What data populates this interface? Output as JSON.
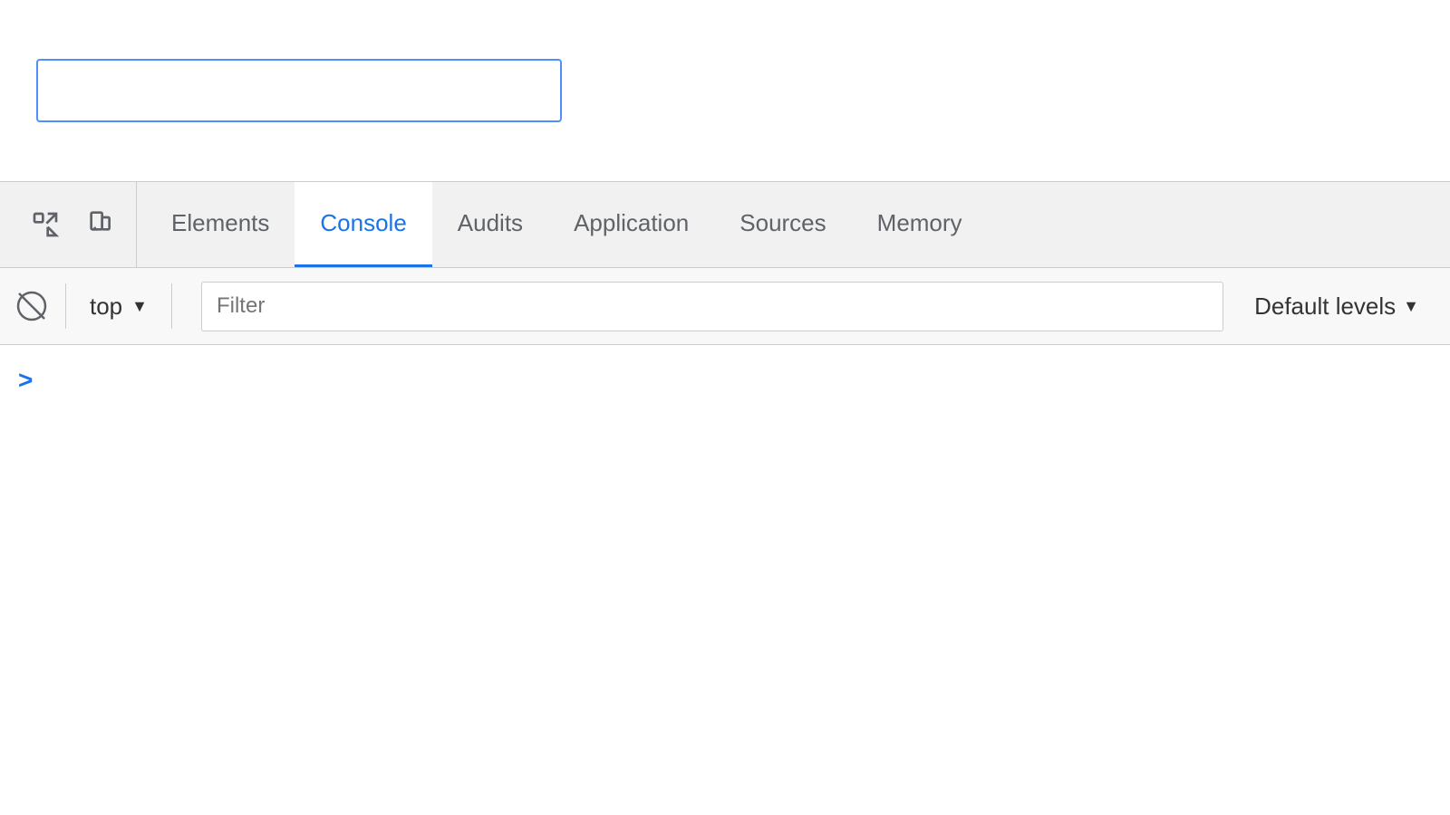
{
  "url_bar": {
    "value": "",
    "placeholder": ""
  },
  "devtools": {
    "tab_bar": {
      "tabs": [
        {
          "id": "elements",
          "label": "Elements",
          "active": false
        },
        {
          "id": "console",
          "label": "Console",
          "active": true
        },
        {
          "id": "audits",
          "label": "Audits",
          "active": false
        },
        {
          "id": "application",
          "label": "Application",
          "active": false
        },
        {
          "id": "sources",
          "label": "Sources",
          "active": false
        },
        {
          "id": "memory",
          "label": "Memory",
          "active": false
        }
      ]
    },
    "console_toolbar": {
      "context": "top",
      "filter_placeholder": "Filter",
      "default_levels_label": "Default levels"
    },
    "console_prompt_arrow": ">"
  },
  "icons": {
    "inspect_element": "⬚↖",
    "device_mode": "⬚"
  }
}
